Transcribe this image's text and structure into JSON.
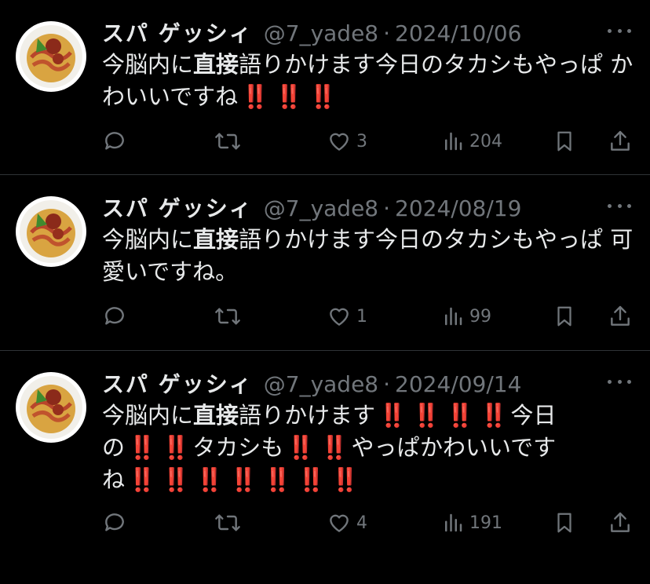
{
  "tweets": [
    {
      "name": "スパ ゲッシィ",
      "handle": "@7_yade8",
      "separator": "·",
      "date": "2024/10/06",
      "segments": [
        {
          "t": "今脳内に"
        },
        {
          "t": "直接",
          "bold": true
        },
        {
          "t": "語りかけます今日のタカシもやっぱ かわいいですね"
        },
        {
          "t": "‼️",
          "bang": true
        },
        {
          "t": "‼️",
          "bang": true
        },
        {
          "t": "‼️",
          "bang": true
        }
      ],
      "likes": "3",
      "views": "204"
    },
    {
      "name": "スパ ゲッシィ",
      "handle": "@7_yade8",
      "separator": "·",
      "date": "2024/08/19",
      "segments": [
        {
          "t": "今脳内に"
        },
        {
          "t": "直接",
          "bold": true
        },
        {
          "t": "語りかけます今日のタカシもやっぱ 可愛いですね。"
        }
      ],
      "likes": "1",
      "views": "99"
    },
    {
      "name": "スパ ゲッシィ",
      "handle": "@7_yade8",
      "separator": "·",
      "date": "2024/09/14",
      "segments": [
        {
          "t": "今脳内に"
        },
        {
          "t": "直接",
          "bold": true
        },
        {
          "t": "語りかけます"
        },
        {
          "t": "‼️",
          "bang": true
        },
        {
          "t": "‼️",
          "bang": true
        },
        {
          "t": "‼️",
          "bang": true
        },
        {
          "t": "‼️",
          "bang": true
        },
        {
          "t": "今日の"
        },
        {
          "t": "‼️",
          "bang": true
        },
        {
          "t": "‼️",
          "bang": true
        },
        {
          "t": "タカシも"
        },
        {
          "t": "‼️",
          "bang": true
        },
        {
          "t": "‼️",
          "bang": true
        },
        {
          "t": "やっぱかわいいですね"
        },
        {
          "t": "‼️",
          "bang": true
        },
        {
          "t": "‼️",
          "bang": true
        },
        {
          "t": "‼️",
          "bang": true
        },
        {
          "t": "‼️",
          "bang": true
        },
        {
          "t": "‼️",
          "bang": true
        },
        {
          "t": "‼️",
          "bang": true
        },
        {
          "t": "‼️",
          "bang": true
        }
      ],
      "likes": "4",
      "views": "191"
    }
  ],
  "icons": [
    "reply-icon",
    "retweet-icon",
    "like-icon",
    "views-icon",
    "bookmark-icon",
    "share-icon",
    "more-icon"
  ],
  "colors": {
    "background": "#000000",
    "text": "#e7e9ea",
    "muted": "#71767b",
    "divider": "#2f3336",
    "bang": "#e0211f"
  }
}
